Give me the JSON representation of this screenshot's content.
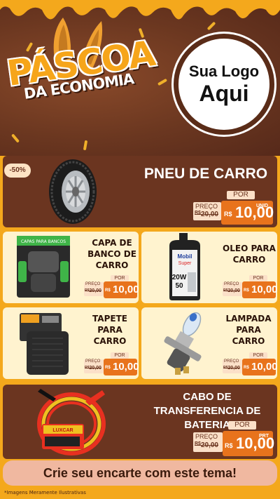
{
  "header": {
    "title_main": "PÁSCOA",
    "title_sub": "DA ECONOMIA",
    "logo_line1": "Sua Logo",
    "logo_line2": "Aqui"
  },
  "discount_badge": "-50%",
  "products": [
    {
      "name": "PNEU DE CARRO",
      "image": "tire-image",
      "por": "POR",
      "preco": "PREÇO",
      "old_price": "20,00",
      "rs": "R$",
      "new_price": "10,00",
      "unit": "UNID"
    },
    {
      "name": "CAPA DE BANCO DE CARRO",
      "image": "seat-cover-image",
      "por": "POR",
      "preco": "PREÇO",
      "old_price": "20,00",
      "rs": "R$",
      "new_price": "10,00",
      "unit": ""
    },
    {
      "name": "OLEO PARA CARRO",
      "image": "motor-oil-image",
      "por": "POR",
      "preco": "PREÇO",
      "old_price": "20,00",
      "rs": "R$",
      "new_price": "10,00",
      "unit": ""
    },
    {
      "name": "TAPETE PARA CARRO",
      "image": "car-mat-image",
      "por": "POR",
      "preco": "PREÇO",
      "old_price": "20,00",
      "rs": "R$",
      "new_price": "10,00",
      "unit": ""
    },
    {
      "name": "LAMPADA PARA CARRO",
      "image": "headlight-bulb-image",
      "por": "POR",
      "preco": "PREÇO",
      "old_price": "20,00",
      "rs": "R$",
      "new_price": "10,00",
      "unit": ""
    },
    {
      "name": "CABO DE TRANSFERENCIA DE BATERIA",
      "image": "jumper-cable-image",
      "por": "POR",
      "preco": "PREÇO",
      "old_price": "20,00",
      "rs": "R$",
      "new_price": "10,00",
      "unit": "PRT"
    }
  ],
  "product_texts": {
    "seat_cover_brand": "CAPAS PARA BANCOS",
    "oil_brand_1": "Mobil",
    "oil_brand_2": "Super",
    "oil_grade_1": "20W",
    "oil_grade_2": "50",
    "cable_brand": "LUXCAR"
  },
  "cta": "Crie seu encarte com este tema!",
  "disclaimer": "*Imagens Meramente Ilustrativas",
  "colors": {
    "chocolate": "#6b3520",
    "orange": "#e8731c",
    "yellow": "#f4a81c",
    "cream": "#fff3cf"
  }
}
